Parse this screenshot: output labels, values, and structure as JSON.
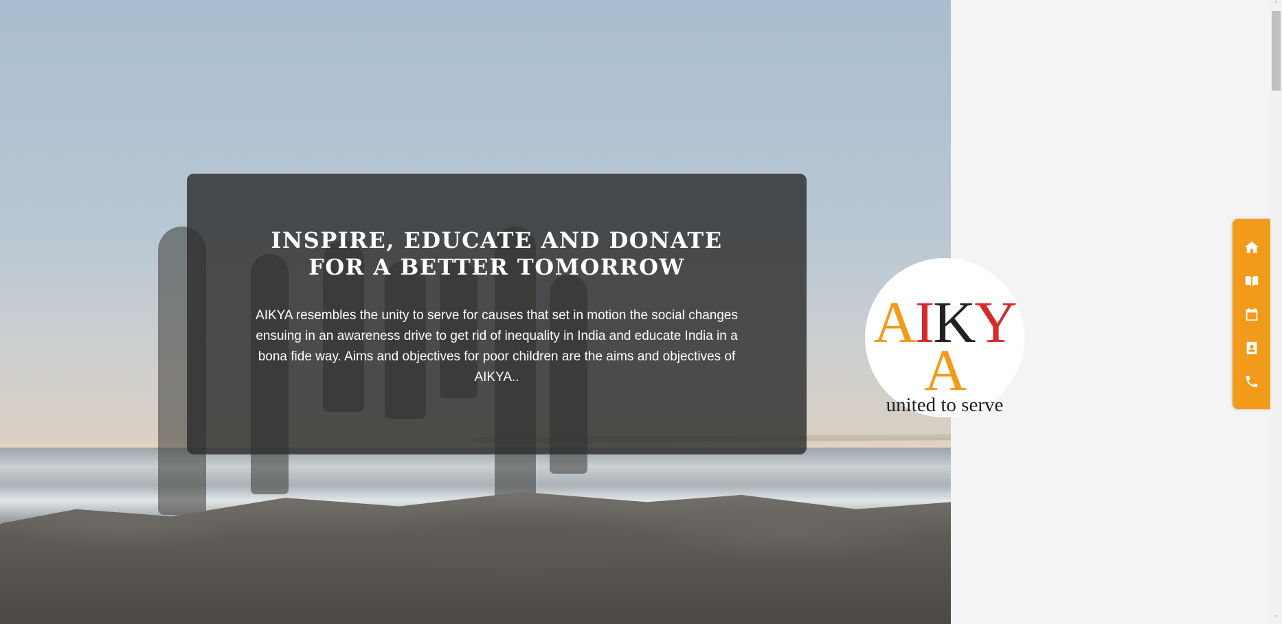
{
  "hero": {
    "heading": "INSPIRE, EDUCATE AND DONATE FOR A BETTER TOMORROW",
    "description": "AIKYA resembles the unity to serve for causes that set in motion the social changes ensuing in an awareness drive to get rid of inequality in India and educate India in a bona fide way. Aims and objectives for poor children are the aims and objectives of AIKYA.."
  },
  "logo": {
    "letters": [
      "A",
      "I",
      "K",
      "Y",
      "A"
    ],
    "letter_colors": [
      "#f29a1a",
      "#d62b2b",
      "#222222",
      "#d62b2b",
      "#f29a1a"
    ],
    "tagline": "united to serve"
  },
  "sidenav": {
    "color": "#f29a1a",
    "items": [
      {
        "icon": "home-icon"
      },
      {
        "icon": "book-icon"
      },
      {
        "icon": "calendar-icon"
      },
      {
        "icon": "contact-card-icon"
      },
      {
        "icon": "phone-icon"
      }
    ]
  },
  "scrollbar": {
    "up": "˄",
    "down": "˅"
  }
}
